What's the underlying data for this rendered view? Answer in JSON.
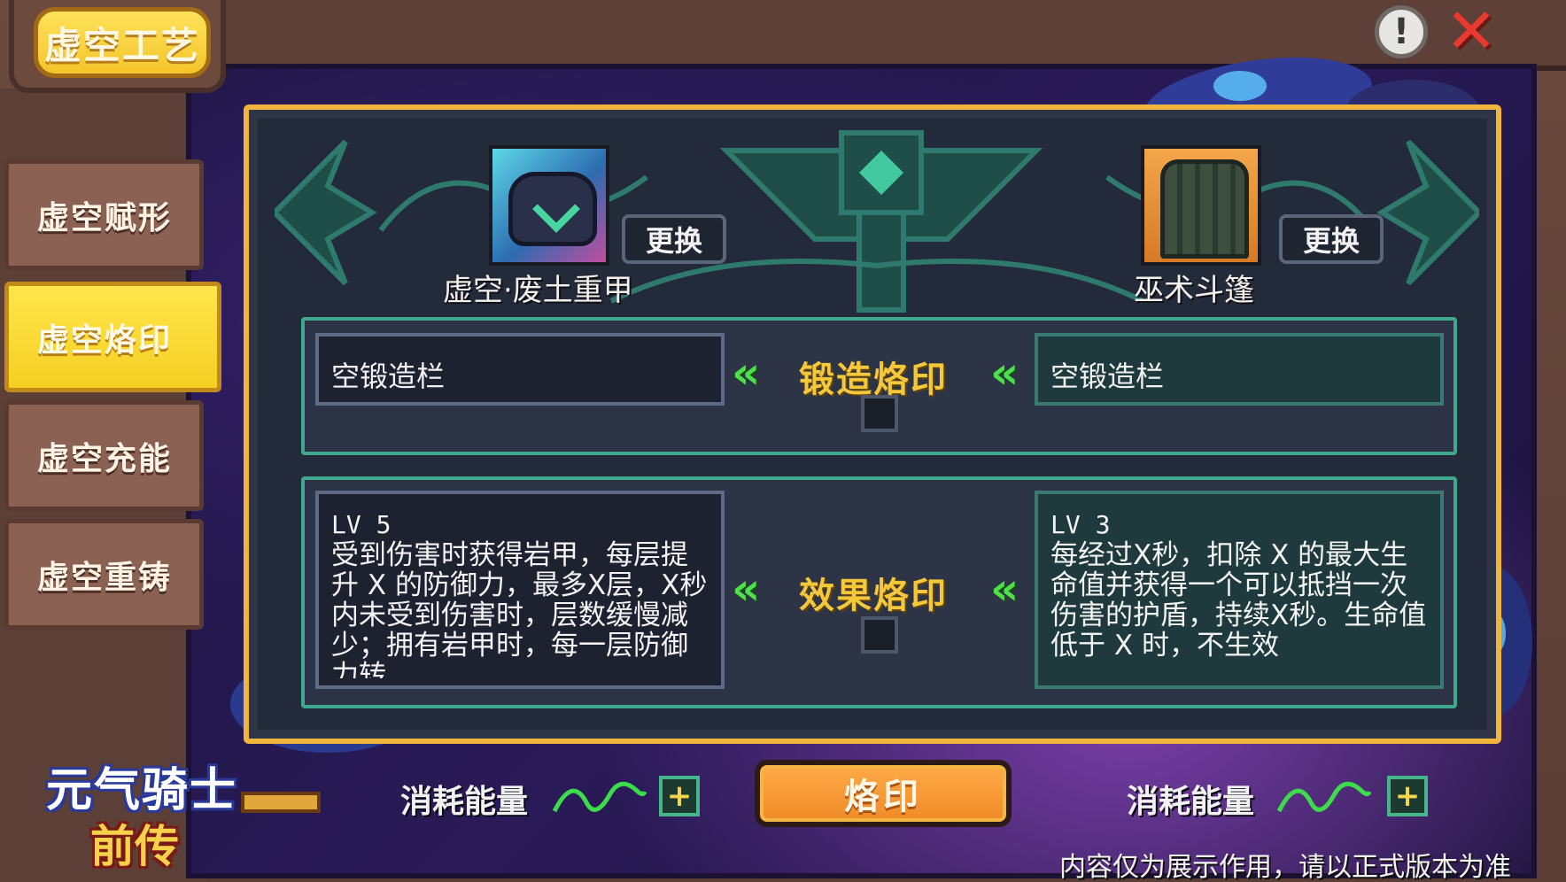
{
  "header": {
    "title": "虚空工艺",
    "tip_icon": "exclamation-icon",
    "close_icon": "close-icon"
  },
  "sidebar": {
    "items": [
      {
        "label": "虚空赋形",
        "active": false
      },
      {
        "label": "虚空烙印",
        "active": true
      },
      {
        "label": "虚空充能",
        "active": false
      },
      {
        "label": "虚空重铸",
        "active": false
      }
    ]
  },
  "items": {
    "left": {
      "name": "虚空·废土重甲",
      "swap_label": "更换",
      "icon": "heavy-armor-icon"
    },
    "right": {
      "name": "巫术斗篷",
      "swap_label": "更换",
      "icon": "cloak-icon"
    }
  },
  "forge": {
    "left_slot": "空锻造栏",
    "center_label": "锻造烙印",
    "right_slot": "空锻造栏"
  },
  "effect": {
    "center_label": "效果烙印",
    "left": {
      "level": "LV 5",
      "text": "受到伤害时获得岩甲，每层提升 X 的防御力，最多X层，X秒内未受到伤害时，层数缓慢减少；拥有岩甲时，每一层防御力转"
    },
    "right": {
      "level": "LV 3",
      "text": "每经过X秒，扣除 X 的最大生命值并获得一个可以抵挡一次伤害的护盾，持续X秒。生命值低于 X 时，不生效"
    }
  },
  "footer": {
    "cost_label_left": "消耗能量",
    "cost_label_right": "消耗能量",
    "imprint_button": "烙印",
    "disclaimer": "内容仅为展示作用，请以正式版本为准"
  },
  "logo": {
    "line1": "元气骑士",
    "line2": "前传"
  },
  "colors": {
    "accent_gold": "#f4c83a",
    "active_tab": "#ffe64c",
    "imprint_orange": "#ef8a26",
    "chevron_green": "#4ee04a",
    "row_border": "#3fa88e"
  }
}
